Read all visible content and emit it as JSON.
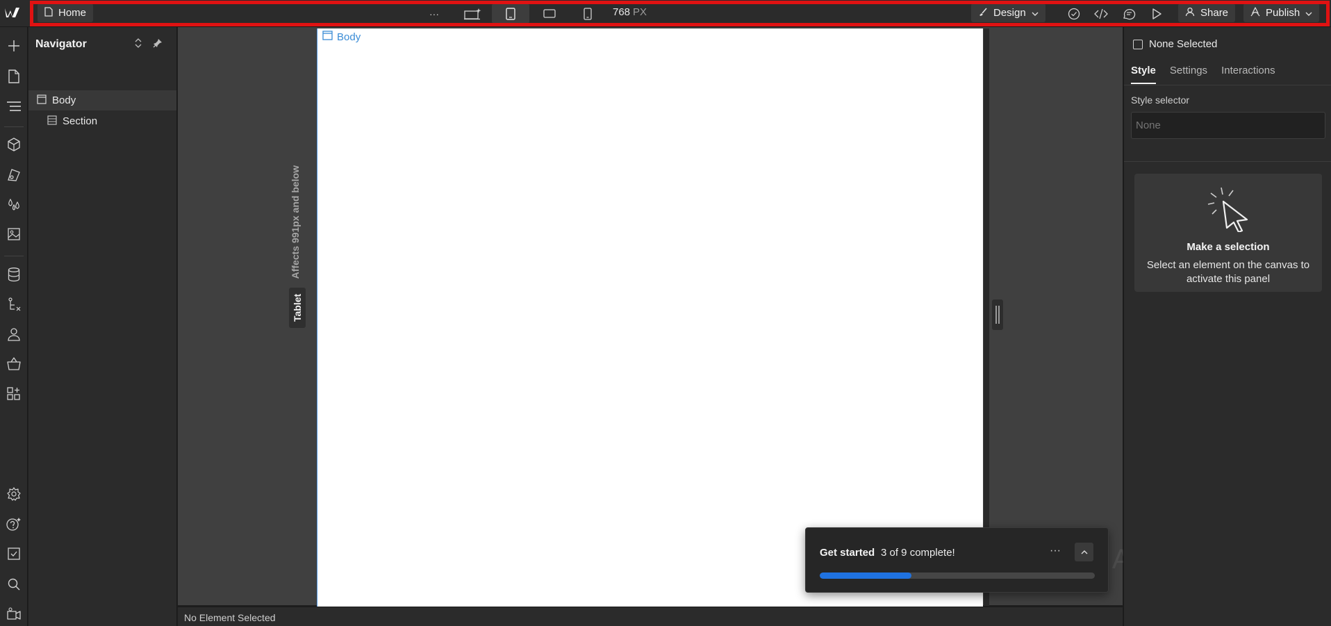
{
  "topbar": {
    "home_label": "Home",
    "more_label": "···",
    "px_value": "768",
    "px_unit": "PX",
    "design_label": "Design",
    "share_label": "Share",
    "publish_label": "Publish"
  },
  "navigator": {
    "title": "Navigator",
    "items": [
      {
        "label": "Body"
      },
      {
        "label": "Section"
      }
    ]
  },
  "canvas": {
    "body_tag": "Body",
    "breakpoint_note": "Affects 991px and below",
    "breakpoint_name": "Tablet"
  },
  "status": {
    "text": "No Element Selected"
  },
  "get_started": {
    "title": "Get started",
    "progress_text": "3 of 9 complete!",
    "completed": 3,
    "total": 9,
    "more_label": "···",
    "fill_color": "#1f72e0"
  },
  "watermark": {
    "text": "ПАРТНЕРКИН"
  },
  "right_panel": {
    "selection_label": "None Selected",
    "tabs": [
      "Style",
      "Settings",
      "Interactions"
    ],
    "style_selector_label": "Style selector",
    "style_selector_placeholder": "None",
    "card_title": "Make a selection",
    "card_text": "Select an element on the canvas to activate this panel"
  },
  "colors": {
    "accent_blue": "#3a8cd6",
    "highlight_frame": "#e01212"
  }
}
